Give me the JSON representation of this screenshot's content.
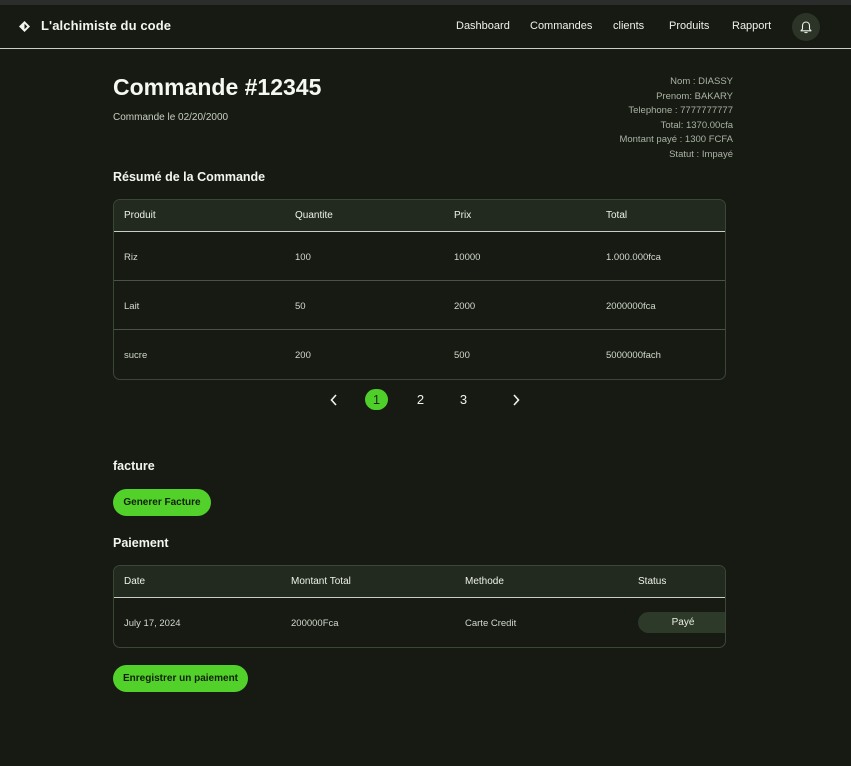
{
  "header": {
    "brand": "L'alchimiste du code",
    "nav": [
      "Dashboard",
      "Commandes",
      "clients",
      "Produits",
      "Rapport"
    ]
  },
  "order": {
    "title": "Commande #12345",
    "date_line": "Commande le 02/20/2000"
  },
  "customer_info": [
    "Nom : DIASSY",
    "Prenom: BAKARY",
    "Telephone : 7777777777",
    "Total: 1370.00cfa",
    "Montant payé : 1300  FCFA",
    "Statut : Impayé"
  ],
  "summary": {
    "title": "Résumé de la Commande",
    "headers": [
      "Produit",
      "Quantite",
      "Prix",
      "Total"
    ],
    "rows": [
      [
        "Riz",
        "100",
        "10000",
        "1.000.000fca"
      ],
      [
        "Lait",
        "50",
        "2000",
        "2000000fca"
      ],
      [
        "sucre",
        "200",
        "500",
        "5000000fach"
      ]
    ]
  },
  "pagination": {
    "pages": [
      "1",
      "2",
      "3"
    ],
    "active": "1"
  },
  "invoice": {
    "title": "facture",
    "button": "Generer Facture"
  },
  "payment": {
    "title": "Paiement",
    "headers": [
      "Date",
      "Montant Total",
      "Methode",
      "Status"
    ],
    "rows": [
      {
        "date": "July 17, 2024",
        "amount": "200000Fca",
        "method": "Carte Credit",
        "status": "Payé"
      }
    ],
    "button": "Enregistrer un paiement"
  },
  "colors": {
    "background": "#161a13",
    "accent": "#52d12a",
    "table_header": "#222a1f"
  }
}
